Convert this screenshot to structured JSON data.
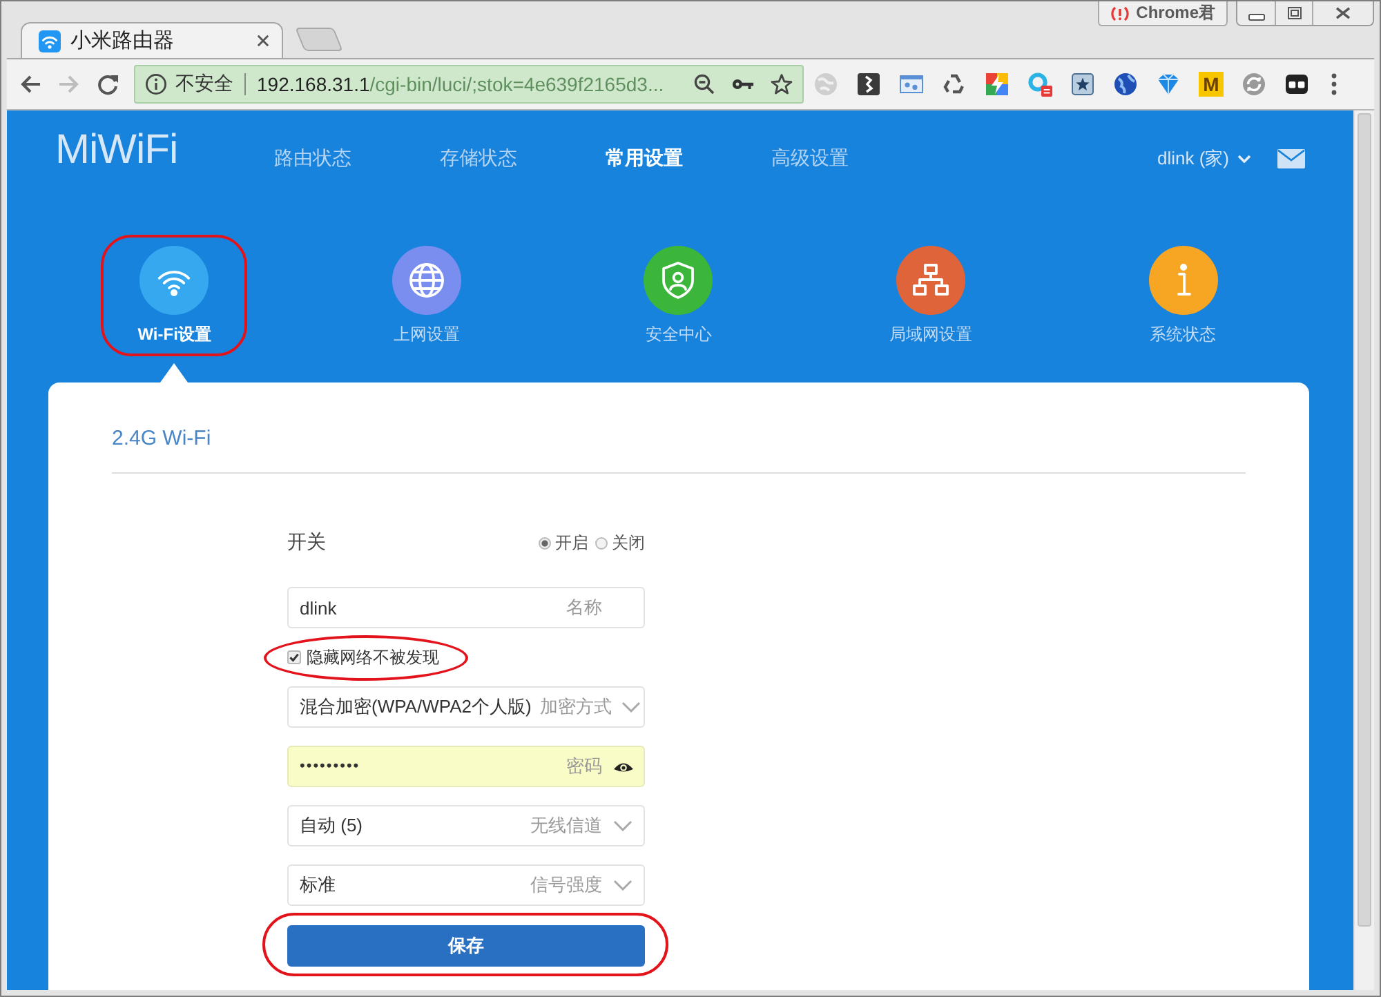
{
  "browser": {
    "tabs": [
      {
        "title": "小米路由器",
        "selected": true
      }
    ],
    "profile_badge": "Chrome君",
    "nav_buttons": [
      {
        "kind": "back",
        "disabled": false
      },
      {
        "kind": "forward",
        "disabled": true
      },
      {
        "kind": "reload",
        "disabled": false
      }
    ],
    "address_bar": {
      "security": "不安全",
      "host": "192.168.31.1",
      "path": "/cgi-bin/luci/;stok=4e639f2165d3..."
    },
    "extension_letter": "M"
  },
  "header": {
    "logo": "MiWiFi",
    "nav": [
      {
        "label": "路由状态",
        "selected": false
      },
      {
        "label": "存储状态",
        "selected": false
      },
      {
        "label": "常用设置",
        "selected": true
      },
      {
        "label": "高级设置",
        "selected": false
      }
    ],
    "user": "dlink (家)"
  },
  "quick_nav": [
    {
      "kind": "wifi",
      "label": "Wi-Fi设置",
      "color": "#35a8f0",
      "selected": true,
      "highlighted": true
    },
    {
      "kind": "globe",
      "label": "上网设置",
      "color": "#7a8ef0",
      "selected": false,
      "highlighted": false
    },
    {
      "kind": "shield",
      "label": "安全中心",
      "color": "#3bb53a",
      "selected": false,
      "highlighted": false
    },
    {
      "kind": "network",
      "label": "局域网设置",
      "color": "#e0643a",
      "selected": false,
      "highlighted": false
    },
    {
      "kind": "info",
      "label": "系统状态",
      "color": "#f6a623",
      "selected": false,
      "highlighted": false
    }
  ],
  "card": {
    "title": "2.4G Wi-Fi",
    "switch": {
      "label": "开关",
      "options": [
        {
          "label": "开启",
          "selected": true
        },
        {
          "label": "关闭",
          "selected": false
        }
      ]
    },
    "fields": [
      {
        "kind": "text",
        "value": "dlink",
        "hint": "名称",
        "autofilled": false,
        "highlighted": false
      },
      {
        "kind": "checkbox",
        "label": "隐藏网络不被发现",
        "checked": true,
        "highlighted": true
      },
      {
        "kind": "select",
        "value": "混合加密(WPA/WPA2个人版)",
        "hint": "加密方式",
        "autofilled": false,
        "highlighted": false
      },
      {
        "kind": "password",
        "value": "•••••••••",
        "hint": "密码",
        "autofilled": true,
        "highlighted": false
      },
      {
        "kind": "select",
        "value": "自动 (5)",
        "hint": "无线信道",
        "autofilled": false,
        "highlighted": false
      },
      {
        "kind": "select",
        "value": "标准",
        "hint": "信号强度",
        "autofilled": false,
        "highlighted": false
      }
    ],
    "save_button": {
      "label": "保存",
      "highlighted": true
    }
  }
}
